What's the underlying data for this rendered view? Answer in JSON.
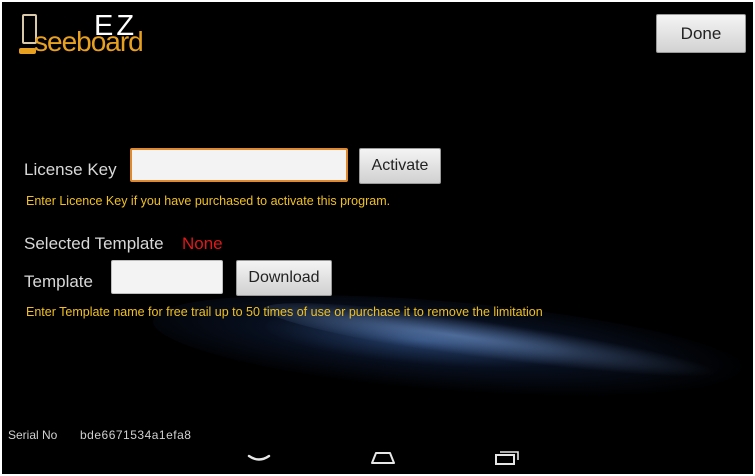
{
  "app": {
    "logo_ez": "EZ",
    "logo_name": "seeboard"
  },
  "header": {
    "done_label": "Done"
  },
  "license": {
    "label": "License Key",
    "value": "",
    "activate_label": "Activate",
    "hint": "Enter Licence Key if you have purchased to activate this program."
  },
  "selected_template": {
    "label": "Selected Template",
    "value": "None"
  },
  "template": {
    "label": "Template",
    "value": "",
    "download_label": "Download",
    "hint": "Enter Template name for free trail up to 50 times of use or purchase it to remove the limitation"
  },
  "serial": {
    "label": "Serial No",
    "value": "bde6671534a1efa8"
  },
  "nav": {
    "icons": [
      "back-icon",
      "home-icon",
      "recent-apps-icon"
    ]
  },
  "colors": {
    "background": "#000000",
    "hint": "#f0c020",
    "selected_value": "#e01818",
    "logo": "#e8a020",
    "input_focus_border": "#e08a30"
  }
}
